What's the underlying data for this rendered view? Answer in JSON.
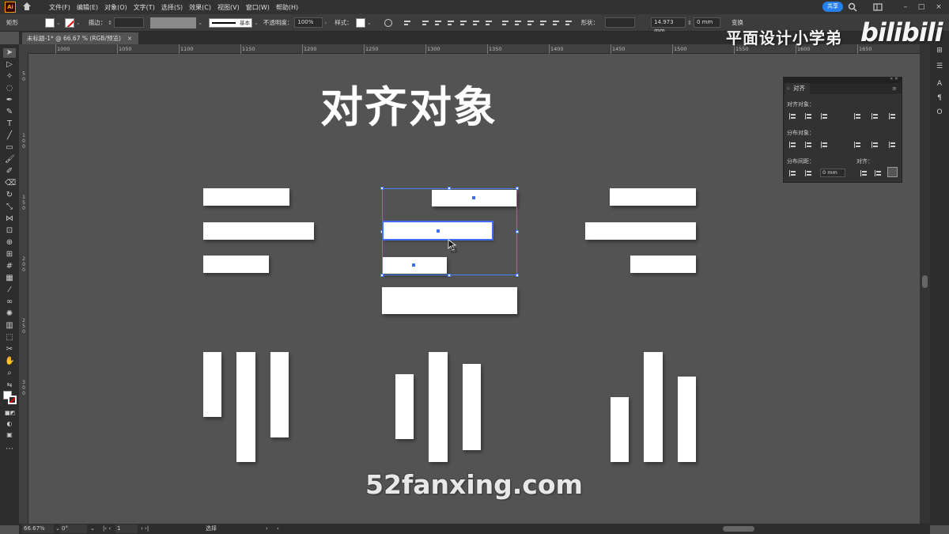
{
  "menubar": {
    "app_logo": "Ai",
    "items": [
      "文件(F)",
      "编辑(E)",
      "对象(O)",
      "文字(T)",
      "选择(S)",
      "效果(C)",
      "视图(V)",
      "窗口(W)",
      "帮助(H)"
    ],
    "share_label": "共享"
  },
  "controlbar": {
    "object_type": "矩形",
    "stroke_label": "描边：",
    "stroke_style": "基本",
    "opacity_label": "不透明度：",
    "opacity_value": "100%",
    "style_label": "样式：",
    "shape_label": "形状：",
    "width_value": "14.973 mm",
    "radius_value": "0 mm",
    "transform_label": "变换"
  },
  "document": {
    "tab_title": "未标题-1* @ 66.67 % (RGB/预览)"
  },
  "ruler": {
    "h_ticks": [
      "1000",
      "1050",
      "1100",
      "1150",
      "1200",
      "1250",
      "1300",
      "1350",
      "1400",
      "1450",
      "1500",
      "1550",
      "1600",
      "1650"
    ],
    "v_ticks": [
      "5 0",
      "1 0 0",
      "1 5 0",
      "2 0 0",
      "2 5 0",
      "3 0 0"
    ]
  },
  "canvas": {
    "headline": "对齐对象"
  },
  "align_panel": {
    "tab_label": "对齐",
    "align_objects_label": "对齐对象：",
    "distribute_objects_label": "分布对象：",
    "distribute_spacing_label": "分布间距：",
    "align_to_label": "对齐：",
    "spacing_value": "0 mm"
  },
  "statusbar": {
    "zoom": "66.67%",
    "rotation": "0°",
    "artboard": "1",
    "tool_name": "选择"
  },
  "watermarks": {
    "channel": "平面设计小学弟",
    "platform": "bilibili",
    "site": "52fanxing.com"
  },
  "colors": {
    "canvas": "#535353",
    "selection": "#3d6ef5",
    "share_button": "#2680eb"
  }
}
